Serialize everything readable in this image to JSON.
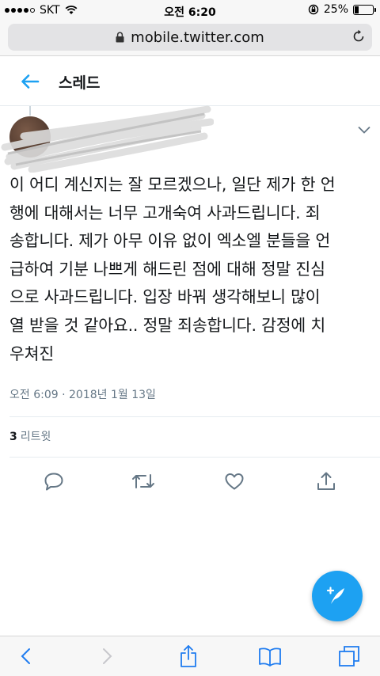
{
  "status_bar": {
    "carrier": "SKT",
    "time": "오전 6:20",
    "battery_percent": "25%",
    "battery_level": 0.25
  },
  "safari": {
    "url": "mobile.twitter.com",
    "icons": [
      "lock-icon",
      "reload-icon",
      "back-icon",
      "forward-icon",
      "share-icon",
      "bookmarks-icon",
      "tabs-icon"
    ]
  },
  "header": {
    "title": "스레드"
  },
  "tweet": {
    "text": "이 어디 계신지는 잘 모르겠으나, 일단 제가 한 언\n행에 대해서는 너무 고개숙여 사과드립니다. 죄\n송합니다. 제가 아무 이유 없이 엑소엘 분들을 언\n급하여 기분 나쁘게 해드린 점에 대해 정말 진심\n으로 사과드립니다. 입장 바꿔 생각해보니 많이\n열 받을 것 같아요.. 정말 죄송합니다. 감정에 치\n우쳐진",
    "timestamp": "오전 6:09 · 2018년 1월 13일",
    "retweet_count": "3",
    "retweet_label": "리트윗"
  },
  "colors": {
    "accent": "#1da1f2",
    "text_primary": "#14171a",
    "text_secondary": "#657786",
    "icon_gray": "#657786"
  }
}
